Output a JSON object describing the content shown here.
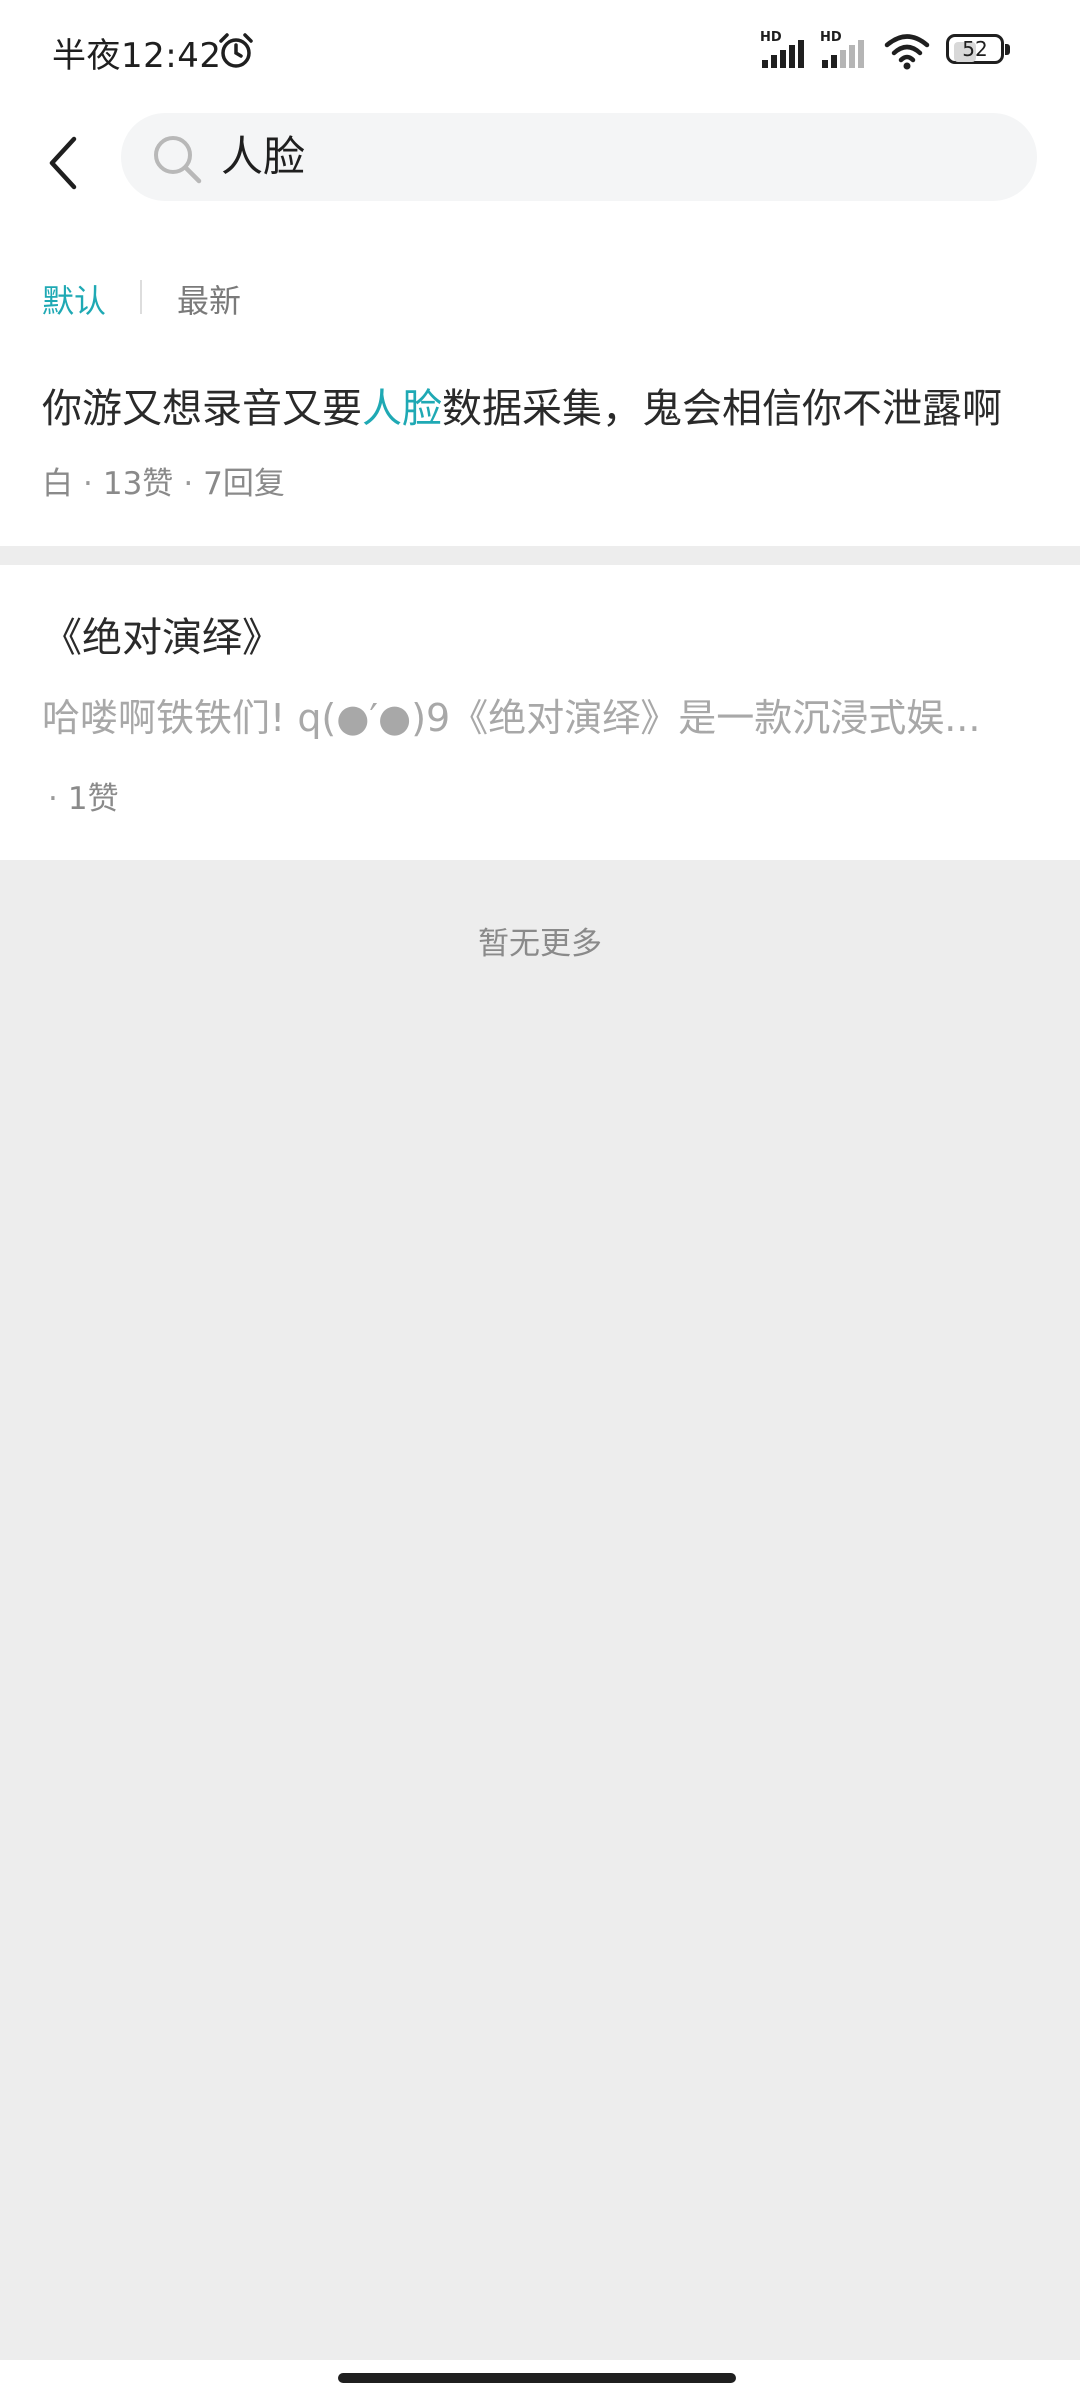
{
  "status_bar": {
    "time": "半夜12:42",
    "signal_1_label": "HD",
    "signal_2_label": "HD",
    "battery_level": "52",
    "battery_fraction": 0.52
  },
  "search": {
    "query": "人脸",
    "placeholder": ""
  },
  "sort_tabs": {
    "default_label": "默认",
    "latest_label": "最新"
  },
  "results": [
    {
      "title_before": "你游又想录音又要",
      "title_highlight": "人脸",
      "title_after": "数据采集，鬼会相信你不泄露啊",
      "author": "白",
      "likes": "13赞",
      "replies": "7回复"
    },
    {
      "title": "《绝对演绎》",
      "summary": "哈喽啊铁铁们! q(●′●)9《绝对演绎》是一款沉浸式娱...",
      "likes": "1赞"
    }
  ],
  "end_text": "暂无更多",
  "colors": {
    "accent": "#1fa9b4",
    "background": "#ededed"
  }
}
